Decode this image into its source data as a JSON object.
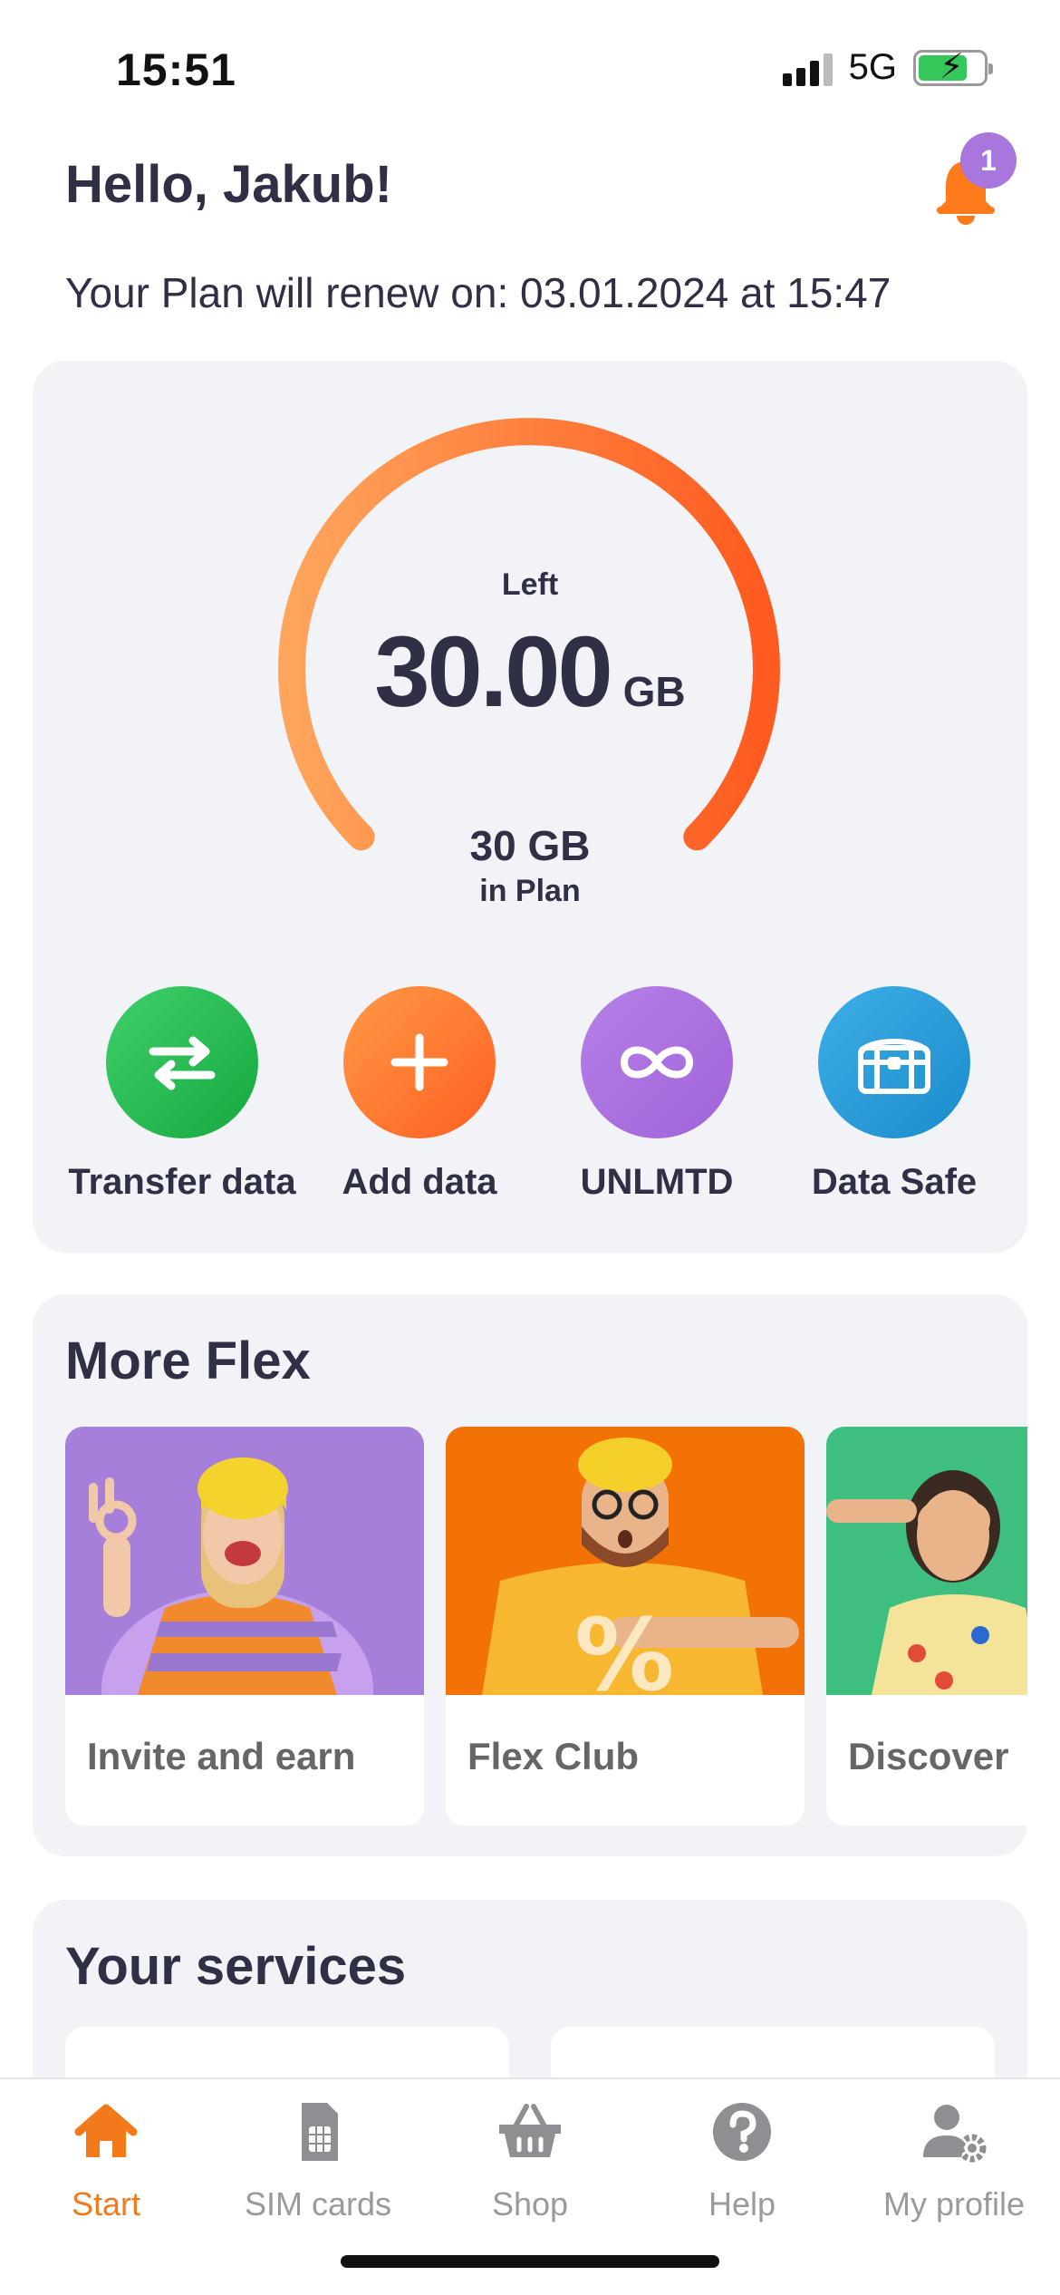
{
  "status_bar": {
    "time": "15:51",
    "network": "5G",
    "battery_level": 0.75,
    "battery_color": "#35c759"
  },
  "header": {
    "greeting": "Hello, Jakub!",
    "notification_count": "1",
    "renew_text": "Your Plan will renew on: 03.01.2024 at 15:47"
  },
  "data_usage": {
    "left_label": "Left",
    "left_value": "30.00",
    "left_unit": "GB",
    "remaining_fraction": 1.0,
    "plan_total": "30 GB",
    "plan_caption": "in Plan",
    "gauge_colors": [
      "#ffa55c",
      "#ff5a1f"
    ]
  },
  "actions": [
    {
      "label": "Transfer data",
      "icon": "transfer-arrows-icon",
      "color_from": "#3fcf6b",
      "color_to": "#16a93f"
    },
    {
      "label": "Add data",
      "icon": "plus-icon",
      "color_from": "#ff9a45",
      "color_to": "#ff5f22"
    },
    {
      "label": "UNLMTD",
      "icon": "infinity-icon",
      "color_from": "#b680e8",
      "color_to": "#a063d8"
    },
    {
      "label": "Data Safe",
      "icon": "treasure-chest-icon",
      "color_from": "#3eaee6",
      "color_to": "#1b8ccc"
    }
  ],
  "more_flex": {
    "title": "More Flex",
    "tiles": [
      {
        "label": "Invite and earn",
        "bg": "#a57fd9",
        "icon": "woman-ok-gesture-photo"
      },
      {
        "label": "Flex Club",
        "bg": "#f27208",
        "icon": "man-percent-shirt-photo"
      },
      {
        "label": "Discover",
        "bg": "#3fbf7f",
        "icon": "woman-binocular-gesture-photo"
      }
    ]
  },
  "services": {
    "title": "Your services"
  },
  "tabbar": {
    "active_color": "#f27a1a",
    "inactive_color": "#9a9a9a",
    "tabs": [
      {
        "label": "Start",
        "icon": "home-icon",
        "active": true
      },
      {
        "label": "SIM cards",
        "icon": "sim-card-icon",
        "active": false
      },
      {
        "label": "Shop",
        "icon": "basket-icon",
        "active": false
      },
      {
        "label": "Help",
        "icon": "help-icon",
        "active": false
      },
      {
        "label": "My profile",
        "icon": "profile-gear-icon",
        "active": false
      }
    ]
  }
}
